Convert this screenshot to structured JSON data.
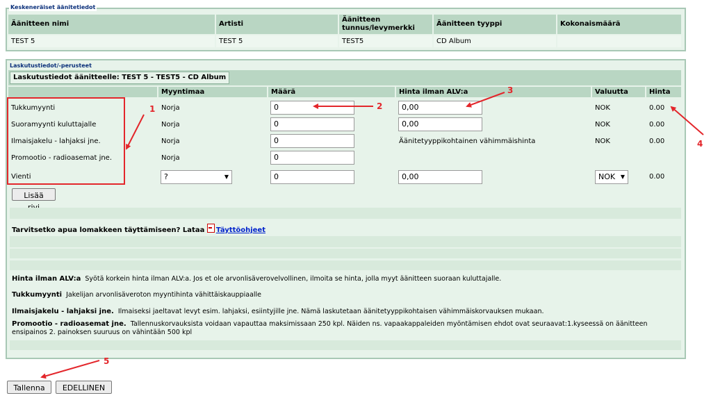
{
  "section1": {
    "legend": "Keskeneräiset äänitetiedot",
    "headers": [
      "Äänitteen nimi",
      "Artisti",
      "Äänitteen tunnus/levymerkki",
      "Äänitteen tyyppi",
      "Kokonaismäärä"
    ],
    "row": [
      "TEST 5",
      "TEST 5",
      "TEST5",
      "CD Album",
      ""
    ]
  },
  "section2": {
    "legend": "Laskutustiedot/-perusteet",
    "title": "Laskutustiedot äänitteelle: TEST 5 - TEST5 - CD Album",
    "headers": [
      "",
      "Myyntimaa",
      "Määrä",
      "Hinta ilman ALV:a",
      "Valuutta",
      "Hinta"
    ],
    "rows": [
      {
        "label": "Tukkumyynti",
        "country": "Norja",
        "amount": "0",
        "price": "0,00",
        "currency": "NOK",
        "total": "0.00"
      },
      {
        "label": "Suoramyynti kuluttajalle",
        "country": "Norja",
        "amount": "0",
        "price": "0,00",
        "currency": "NOK",
        "total": "0.00"
      },
      {
        "label": "Ilmaisjakelu - lahjaksi jne.",
        "country": "Norja",
        "amount": "0",
        "price_text": "Äänitetyyppikohtainen vähimmäishinta",
        "currency": "NOK",
        "total": "0.00"
      },
      {
        "label": "Promootio - radioasemat jne.",
        "country": "Norja",
        "amount": "0"
      },
      {
        "label": "Vienti",
        "country": "?",
        "amount": "0",
        "price": "0,00",
        "currency": "NOK",
        "total": "0.00"
      }
    ],
    "add_row_button": "Lisää rivi",
    "help_text": "Tarvitsetko apua lomakkeen täyttämiseen? Lataa",
    "help_link": "Täyttöohjeet",
    "notes": [
      {
        "term": "Hinta ilman ALV:a",
        "text": "Syötä korkein hinta ilman ALV:a. Jos et ole arvonlisäverovelvollinen, ilmoita se hinta, jolla myyt äänitteen suoraan kuluttajalle."
      },
      {
        "term": "Tukkumyynti",
        "text": "Jakelijan arvonlisäveroton myyntihinta vähittäiskauppiaalle"
      },
      {
        "term": "Ilmaisjakelu - lahjaksi jne.",
        "text": "Ilmaiseksi jaeltavat levyt esim. lahjaksi, esiintyjille jne. Nämä laskutetaan äänitetyyppikohtaisen vähimmäiskorvauksen mukaan."
      },
      {
        "term": "Promootio - radioasemat jne.",
        "text": "Tallennuskorvauksista voidaan vapauttaa maksimissaan 250 kpl. Näiden ns. vapaakappaleiden myöntämisen ehdot ovat seuraavat:1.kyseessä on äänitteen ensipainos 2. painoksen suuruus on vähintään 500 kpl"
      }
    ]
  },
  "buttons": {
    "save": "Tallenna",
    "previous": "EDELLINEN"
  },
  "annotations": [
    "1",
    "2",
    "3",
    "4",
    "5"
  ],
  "colors": {
    "header_bg": "#b9d6c3",
    "panel_bg": "#e7f3ea",
    "border": "#a8c8b5",
    "annotation": "#e3262b",
    "legend_text": "#0a2f7a"
  }
}
